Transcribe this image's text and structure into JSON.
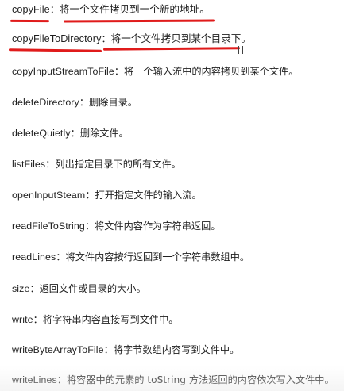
{
  "document": {
    "separator": "：",
    "items": [
      {
        "term": "copyFile",
        "description": "将一个文件拷贝到一个新的地址。"
      },
      {
        "term": "copyFileToDirectory",
        "description": "将一个文件拷贝到某个目录下。"
      },
      {
        "term": "copyInputStreamToFile",
        "description": "将一个输入流中的内容拷贝到某个文件。"
      },
      {
        "term": "deleteDirectory",
        "description": "删除目录。"
      },
      {
        "term": "deleteQuietly",
        "description": "删除文件。"
      },
      {
        "term": "listFiles",
        "description": "列出指定目录下的所有文件。"
      },
      {
        "term": "openInputSteam",
        "description": "打开指定文件的输入流。"
      },
      {
        "term": "readFileToString",
        "description": "将文件内容作为字符串返回。"
      },
      {
        "term": "readLines",
        "description": "将文件内容按行返回到一个字符串数组中。"
      },
      {
        "term": "size",
        "description": "返回文件或目录的大小。"
      },
      {
        "term": "write",
        "description": "将字符串内容直接写到文件中。"
      },
      {
        "term": "writeByteArrayToFile",
        "description": "将字节数组内容写到文件中。"
      },
      {
        "term": "writeLines",
        "description": "将容器中的元素的 toString 方法返回的内容依次写入文件中。"
      }
    ]
  },
  "annotations": {
    "underline_color": "#e01b1b"
  }
}
